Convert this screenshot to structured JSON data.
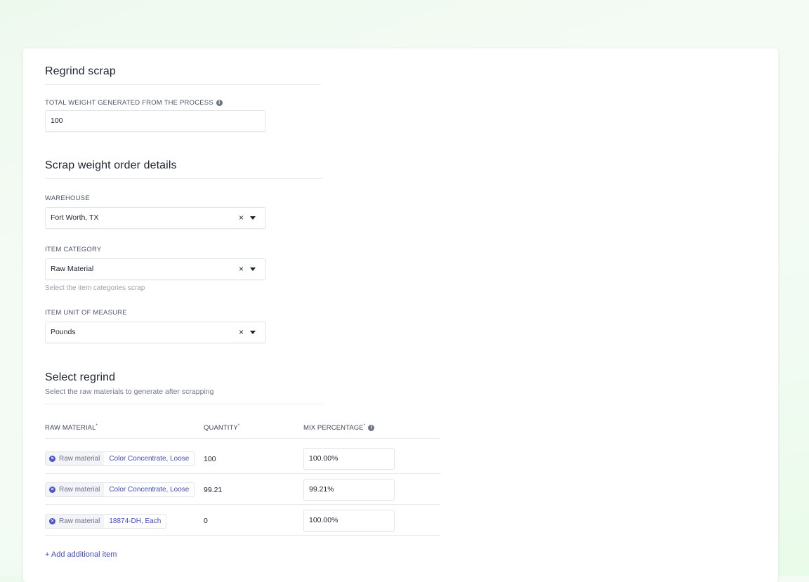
{
  "regrind_scrap": {
    "title": "Regrind scrap",
    "total_weight_label": "TOTAL WEIGHT GENERATED FROM THE PROCESS",
    "total_weight_value": "100"
  },
  "scrap_weight_order": {
    "title": "Scrap weight order details",
    "warehouse_label": "WAREHOUSE",
    "warehouse_value": "Fort Worth, TX",
    "item_category_label": "ITEM CATEGORY",
    "item_category_value": "Raw Material",
    "item_category_hint": "Select the item categories scrap",
    "uom_label": "ITEM UNIT OF MEASURE",
    "uom_value": "Pounds",
    "clear_glyph": "×"
  },
  "select_regrind": {
    "title": "Select regrind",
    "subtitle": "Select the raw materials to generate after scrapping",
    "columns": {
      "raw_material": "RAW MATERIAL",
      "quantity": "QUANTITY",
      "mix_percentage": "MIX PERCENTAGE",
      "required_mark": "*"
    },
    "rows": [
      {
        "tag": "Raw material",
        "item": "Color Concentrate, Loose",
        "quantity": "100",
        "mix": "100.00%"
      },
      {
        "tag": "Raw material",
        "item": "Color Concentrate, Loose",
        "quantity": "99.21",
        "mix": "99.21%"
      },
      {
        "tag": "Raw material",
        "item": "18874-DH, Each",
        "quantity": "0",
        "mix": "100.00%"
      }
    ],
    "add_item_label": "+ Add additional item"
  },
  "icons": {
    "info": "info-icon",
    "clear": "close-icon",
    "dropdown": "caret-down-icon",
    "remove_chip": "remove-circle-icon"
  },
  "colors": {
    "accent": "#3f4cc2",
    "background": "#eef9ee"
  }
}
